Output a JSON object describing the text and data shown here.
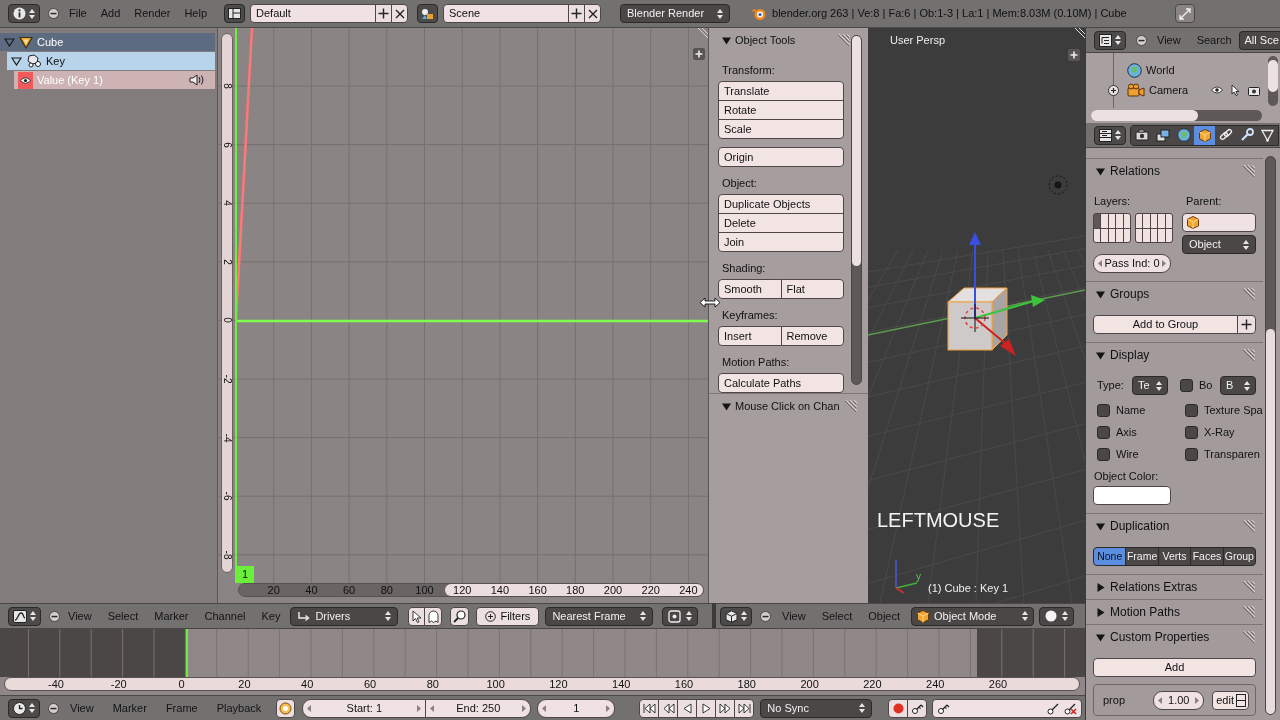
{
  "top_bar": {
    "menus": [
      "File",
      "Add",
      "Render",
      "Help"
    ],
    "screen_layout": "Default",
    "scene": "Scene",
    "render_engine": "Blender Render",
    "stats": "blender.org 263 | Ve:8 | Fa:6 | Ob:1-3 | La:1 | Mem:8.03M (0.10M) | Cube"
  },
  "channels": [
    {
      "label": "Cube",
      "kind": "object",
      "selected": true,
      "expanded": true,
      "children": [
        {
          "label": "Key",
          "kind": "shape_key",
          "selected": false,
          "expanded": true,
          "children": [
            {
              "label": "Value (Key 1)",
              "kind": "fcurve",
              "selected": true,
              "color": "#f05a5a"
            }
          ]
        }
      ]
    }
  ],
  "graph": {
    "y_ticks": [
      "8",
      "6",
      "4",
      "2",
      "0",
      "-2",
      "-4",
      "-6",
      "-8"
    ],
    "x_ticks": [
      "20",
      "40",
      "60",
      "80",
      "100",
      "120",
      "140",
      "160",
      "180",
      "200",
      "220",
      "240"
    ],
    "current_frame": "1"
  },
  "tool_shelf": {
    "panels": [
      {
        "title": "Object Tools",
        "expanded": true,
        "sections": [
          {
            "label": "Transform:",
            "rows": [
              [
                "Translate"
              ],
              [
                "Rotate"
              ],
              [
                "Scale"
              ]
            ]
          },
          {
            "rows": [
              [
                "Origin"
              ]
            ]
          },
          {
            "label": "Object:",
            "rows": [
              [
                "Duplicate Objects"
              ],
              [
                "Delete"
              ],
              [
                "Join"
              ]
            ]
          },
          {
            "label": "Shading:",
            "rows": [
              [
                "Smooth",
                "Flat"
              ]
            ]
          },
          {
            "label": "Keyframes:",
            "rows": [
              [
                "Insert",
                "Remove"
              ]
            ]
          },
          {
            "label": "Motion Paths:",
            "rows": [
              [
                "Calculate Paths"
              ]
            ]
          }
        ]
      },
      {
        "title": "Mouse Click on Chan",
        "expanded": true
      }
    ]
  },
  "viewport": {
    "view_name": "User Persp",
    "last_event": "LEFTMOUSE",
    "axis_label": "y",
    "object_info": "(1) Cube : Key 1"
  },
  "outliner": {
    "menus": [
      "View",
      "Search"
    ],
    "scope": "All Sce",
    "items": [
      {
        "label": "World",
        "kind": "world"
      },
      {
        "label": "Camera",
        "kind": "camera",
        "expanded": false
      }
    ]
  },
  "properties": {
    "tabs": [
      {
        "kind": "render",
        "selected": false
      },
      {
        "kind": "render_layers",
        "selected": false
      },
      {
        "kind": "world",
        "selected": false
      },
      {
        "kind": "object",
        "selected": true
      },
      {
        "kind": "constraints",
        "selected": false
      },
      {
        "kind": "modifiers",
        "selected": false
      },
      {
        "kind": "data",
        "selected": false
      }
    ],
    "panels": [
      {
        "kind": "relations",
        "title": "Relations",
        "expanded": true,
        "layers_label": "Layers:",
        "layers": [
          true,
          false,
          false,
          false,
          false,
          false,
          false,
          false,
          false,
          false,
          false,
          false,
          false,
          false,
          false,
          false,
          false,
          false,
          false,
          false
        ],
        "parent_label": "Parent:",
        "parent_type": "Object",
        "pass_index": "Pass Ind: 0"
      },
      {
        "kind": "groups",
        "title": "Groups",
        "expanded": true,
        "button": "Add to Group"
      },
      {
        "kind": "display",
        "title": "Display",
        "expanded": true,
        "type_label": "Type:",
        "type_value": "Te",
        "bounds": {
          "label": "Bo",
          "checked": false,
          "value": "B"
        },
        "options": [
          {
            "label": "Name",
            "checked": false
          },
          {
            "label": "Texture Spa",
            "checked": false
          },
          {
            "label": "Axis",
            "checked": false
          },
          {
            "label": "X-Ray",
            "checked": false
          },
          {
            "label": "Wire",
            "checked": false
          },
          {
            "label": "Transparen",
            "checked": false
          }
        ],
        "color_label": "Object Color:"
      },
      {
        "kind": "duplication",
        "title": "Duplication",
        "expanded": true,
        "options": [
          {
            "label": "None",
            "selected": true
          },
          {
            "label": "Frame",
            "selected": false
          },
          {
            "label": "Verts",
            "selected": false
          },
          {
            "label": "Faces",
            "selected": false
          },
          {
            "label": "Group",
            "selected": false
          }
        ]
      },
      {
        "title": "Relations Extras",
        "expanded": false
      },
      {
        "title": "Motion Paths",
        "expanded": false
      },
      {
        "kind": "custom_properties",
        "title": "Custom Properties",
        "expanded": true,
        "button": "Add",
        "props": [
          {
            "name": "prop",
            "value": "1.00",
            "edit": "edit"
          }
        ]
      }
    ]
  },
  "graph_header": {
    "menus": [
      "View",
      "Select",
      "Marker",
      "Channel",
      "Key"
    ],
    "mode": "Drivers",
    "filters": "Filters",
    "snap": "Nearest Frame"
  },
  "viewport_header": {
    "menus": [
      "View",
      "Select",
      "Object"
    ],
    "mode": "Object Mode"
  },
  "timeline": {
    "ticks": [
      "-40",
      "-20",
      "0",
      "20",
      "40",
      "60",
      "80",
      "100",
      "120",
      "140",
      "160",
      "180",
      "200",
      "220",
      "240",
      "260"
    ]
  },
  "timeline_header": {
    "menus": [
      "View",
      "Marker",
      "Frame",
      "Playback"
    ],
    "start": "Start: 1",
    "end": "End: 250",
    "current": "1",
    "sync": "No Sync"
  }
}
